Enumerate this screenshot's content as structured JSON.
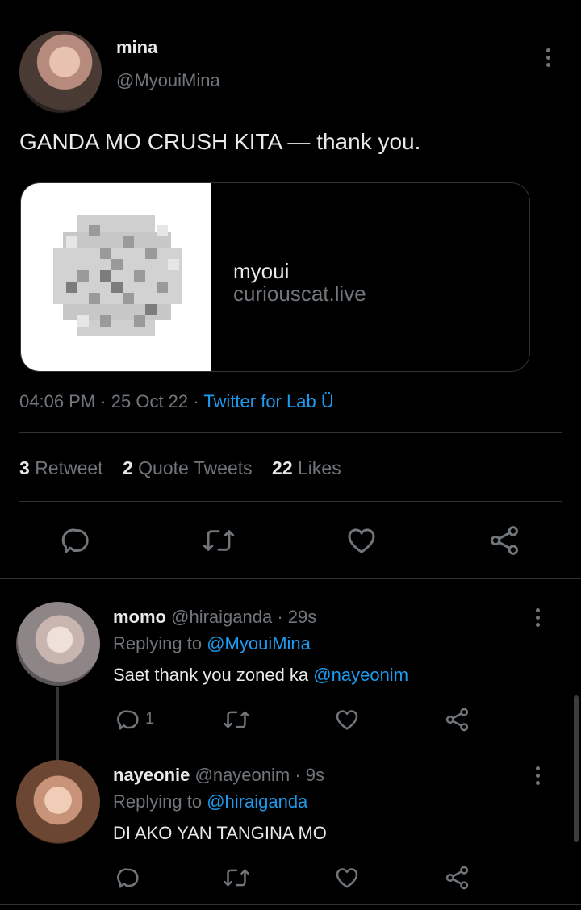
{
  "tweet": {
    "author": {
      "name": "mina",
      "handle": "@MyouiMina"
    },
    "text": "GANDA MO CRUSH KITA — thank you.",
    "card": {
      "title": "myoui",
      "domain": "curiouscat.live"
    },
    "time": "04:06 PM",
    "sep1": "·",
    "date": "25 Oct 22",
    "sep2": "·",
    "source": "Twitter for Lab Ü",
    "stats": {
      "retweets_count": "3",
      "retweets_label": "Retweet",
      "quotes_count": "2",
      "quotes_label": "Quote Tweets",
      "likes_count": "22",
      "likes_label": "Likes"
    }
  },
  "replies": [
    {
      "name": "momo",
      "handle": "@hiraiganda",
      "time": "· 29s",
      "replying_label": "Replying to",
      "replying_to": "@MyouiMina",
      "text": "Saet thank you zoned ka",
      "mention": "@nayeonim",
      "reply_count": "1"
    },
    {
      "name": "nayeonie",
      "handle": "@nayeonim",
      "time": "· 9s",
      "replying_label": "Replying to",
      "replying_to": "@hiraiganda",
      "text": "DI AKO YAN TANGINA MO"
    }
  ],
  "colors": {
    "background": "#000000",
    "text": "#e7e9ea",
    "muted": "#71767b",
    "link": "#1d9bf0",
    "divider": "#2f3336"
  },
  "icons": [
    "more-icon",
    "reply-icon",
    "retweet-icon",
    "like-icon",
    "share-icon"
  ]
}
